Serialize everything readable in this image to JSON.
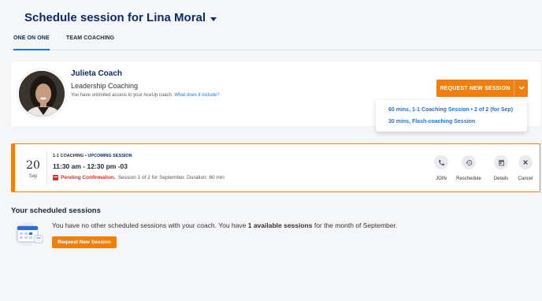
{
  "header": {
    "title": "Schedule session for Lina Moral"
  },
  "tabs": [
    {
      "label": "ONE ON ONE",
      "active": true
    },
    {
      "label": "TEAM COACHING",
      "active": false
    }
  ],
  "coach": {
    "name": "Julieta Coach",
    "role": "Leadership Coaching",
    "note": "You have unlimited access to your AceUp coach.",
    "link": "What does it include?"
  },
  "request_button": {
    "label": "REQUEST NEW SESSION"
  },
  "dropdown": {
    "items": [
      "60 mins, 1-1 Coaching Session • 2 of 2 (for Sep)",
      "30 mins, Flash-coaching Session"
    ]
  },
  "session": {
    "day": "20",
    "month": "Sep",
    "kind": "1-1 COACHING •",
    "status": "UPCOMING SESSION",
    "time": "11:30 am - 12:30 pm -03",
    "pending": "Pending Confirmation.",
    "details": "Session 1 of 2 for September. Duration: 60 min",
    "actions": [
      {
        "label": "JOIN",
        "icon": "phone-icon"
      },
      {
        "label": "Reschedule",
        "icon": "history-icon"
      },
      {
        "label": "Details",
        "icon": "calendar-icon"
      },
      {
        "label": "Cancel",
        "icon": "close-icon"
      }
    ]
  },
  "scheduled": {
    "heading": "Your scheduled sessions",
    "text_before": "You have no other scheduled sessions with your coach. You have ",
    "text_bold": "1 available sessions",
    "text_after": " for the month of September.",
    "button": "Request New Session"
  },
  "colors": {
    "accent": "#f07f0c",
    "title": "#0e2a6b",
    "link": "#1a73e8",
    "pending": "#d93025"
  }
}
